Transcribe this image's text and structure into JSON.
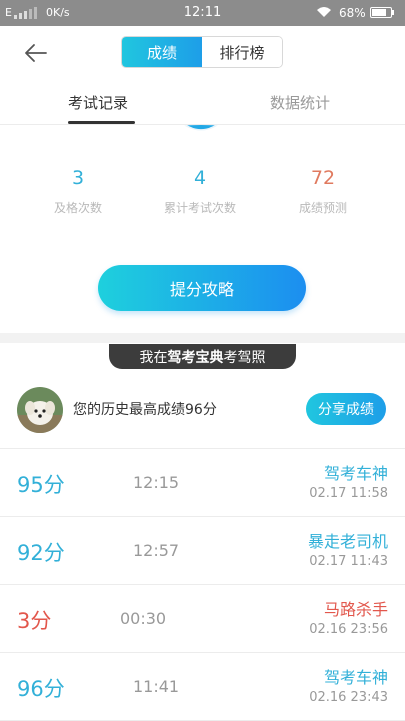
{
  "status_bar": {
    "network": "E",
    "speed": "0K/s",
    "time": "12:11",
    "battery": "68%"
  },
  "header": {
    "tabs": [
      "成绩",
      "排行榜"
    ],
    "active_tab": 0
  },
  "subtabs": [
    "考试记录",
    "数据统计"
  ],
  "stats": [
    {
      "value": "3",
      "label": "及格次数",
      "color": "#32b0d8"
    },
    {
      "value": "4",
      "label": "累计考试次数",
      "color": "#32b0d8"
    },
    {
      "value": "72",
      "label": "成绩预测",
      "color": "#e07a5f"
    }
  ],
  "cta_label": "提分攻略",
  "banner": {
    "prefix": "我在",
    "brand": "驾考宝典",
    "suffix": "考驾照"
  },
  "best": {
    "text": "您的历史最高成绩96分",
    "share_label": "分享成绩"
  },
  "records": [
    {
      "score": "95分",
      "duration": "12:15",
      "title": "驾考车神",
      "datetime": "02.17  11:58",
      "color": "blue"
    },
    {
      "score": "92分",
      "duration": "12:57",
      "title": "暴走老司机",
      "datetime": "02.17  11:43",
      "color": "blue"
    },
    {
      "score": "3分",
      "duration": "00:30",
      "title": "马路杀手",
      "datetime": "02.16  23:56",
      "color": "red"
    },
    {
      "score": "96分",
      "duration": "11:41",
      "title": "驾考车神",
      "datetime": "02.16  23:43",
      "color": "blue"
    }
  ],
  "colors": {
    "accent": "#1e9ee8",
    "accent_light": "#20c6df",
    "fail": "#e2574c",
    "predict": "#e07a5f"
  }
}
